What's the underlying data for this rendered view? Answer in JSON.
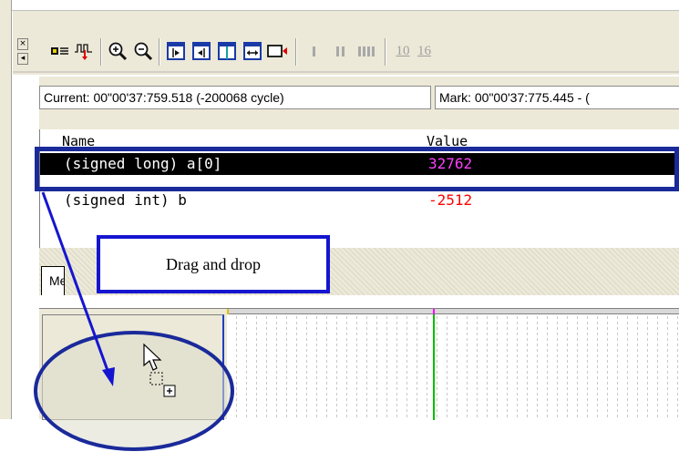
{
  "toolbar": {
    "icons": [
      "collapse-icon",
      "expand-icon",
      "signal-list-icon",
      "signal-add-icon",
      "zoom-in-icon",
      "zoom-out-icon",
      "go-start-icon",
      "go-left-icon",
      "go-mark-icon",
      "fit-range-icon",
      "go-end-icon",
      "bar-1-icon",
      "bar-2-icon",
      "bar-4-icon",
      "radix-10-icon",
      "radix-16-icon"
    ],
    "radix_10_label": "10",
    "radix_16_label": "16"
  },
  "status": {
    "current": "Current: 00\"00'37:759.518 (-200068 cycle)",
    "mark": "Mark: 00\"00'37:775.445 - ("
  },
  "varlist": {
    "columns": [
      "Name",
      "Value"
    ],
    "rows": [
      {
        "name": "(signed long) a[0]",
        "value": "32762",
        "selected": true
      },
      {
        "name": "(signed int) b",
        "value": "-2512",
        "selected": false
      }
    ]
  },
  "tab": {
    "label": "Me"
  },
  "annotation": {
    "callout": "Drag and drop"
  },
  "colors": {
    "value_color_selected": "#ff40ff",
    "value_color": "#ff0000",
    "annotation_blue": "#1515d0",
    "highlight_rect": "#1a2a9a",
    "ellipse_fill": "#dcdccc",
    "ellipse_stroke": "#1a2a9a",
    "cursor_marker_green": "#00c000",
    "cursor_marker_magenta": "#ff00ff"
  }
}
